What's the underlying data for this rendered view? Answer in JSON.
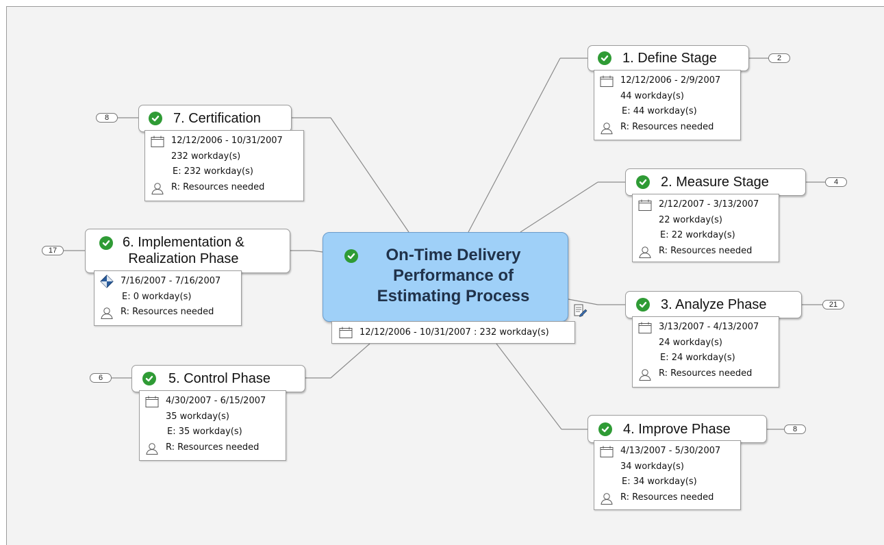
{
  "central": {
    "title": "On-Time Delivery Performance of Estimating Process",
    "info": "12/12/2006 - 10/31/2007 : 232 workday(s)"
  },
  "topics": [
    {
      "title": "1. Define Stage",
      "dates": "12/12/2006 - 2/9/2007",
      "workdays": "44 workday(s)",
      "effort": "E: 44 workday(s)",
      "resources": "R: Resources needed",
      "count": "2"
    },
    {
      "title": "2. Measure Stage",
      "dates": "2/12/2007 - 3/13/2007",
      "workdays": "22 workday(s)",
      "effort": "E: 22 workday(s)",
      "resources": "R: Resources needed",
      "count": "4"
    },
    {
      "title": "3. Analyze Phase",
      "dates": "3/13/2007 - 4/13/2007",
      "workdays": "24 workday(s)",
      "effort": "E: 24 workday(s)",
      "resources": "R: Resources needed",
      "count": "21"
    },
    {
      "title": "4. Improve Phase",
      "dates": "4/13/2007 - 5/30/2007",
      "workdays": "34 workday(s)",
      "effort": "E: 34 workday(s)",
      "resources": "R: Resources needed",
      "count": "8"
    },
    {
      "title": "5. Control Phase",
      "dates": "4/30/2007 - 6/15/2007",
      "workdays": "35 workday(s)",
      "effort": "E: 35 workday(s)",
      "resources": "R: Resources needed",
      "count": "6"
    },
    {
      "title_line1": "6. Implementation &",
      "title_line2": "Realization Phase",
      "dates": "7/16/2007 - 7/16/2007",
      "effort": "E: 0 workday(s)",
      "resources": "R: Resources needed",
      "count": "17"
    },
    {
      "title": "7. Certification",
      "dates": "12/12/2006 - 10/31/2007",
      "workdays": "232 workday(s)",
      "effort": "E: 232 workday(s)",
      "resources": "R: Resources needed",
      "count": "8"
    }
  ],
  "icons": {
    "task_complete": "check-circle-icon",
    "dates": "calendar-icon",
    "resources": "person-icon",
    "milestone": "milestone-diamond-icon",
    "notes": "notes-icon"
  },
  "colors": {
    "central_fill": "#9fd0f8",
    "check_green": "#2f9b35",
    "milestone_blue": "#2a5c9c"
  }
}
